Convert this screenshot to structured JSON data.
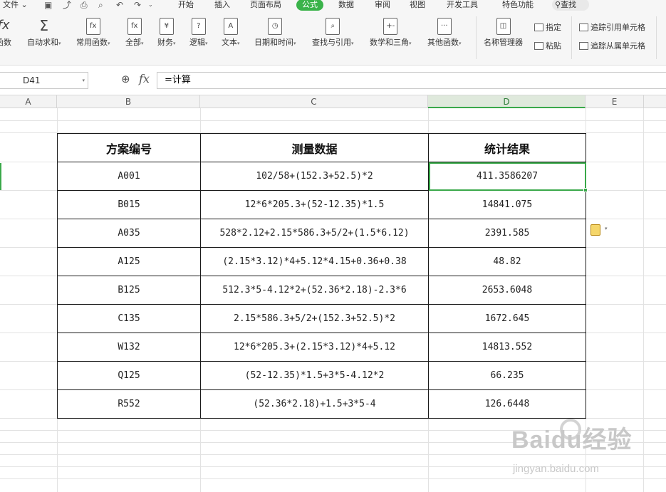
{
  "menubar": {
    "file": "文件",
    "tabs": [
      "开始",
      "插入",
      "页面布局",
      "公式",
      "数据",
      "审阅",
      "视图",
      "开发工具",
      "特色功能"
    ],
    "active_tab": "公式",
    "search": "查找"
  },
  "ribbon": {
    "buttons": [
      {
        "label": "函数",
        "icon": "fx"
      },
      {
        "label": "自动求和",
        "icon": "Σ"
      },
      {
        "label": "常用函数",
        "icon": "fx"
      },
      {
        "label": "全部",
        "icon": "fx"
      },
      {
        "label": "财务",
        "icon": "¥"
      },
      {
        "label": "逻辑",
        "icon": "?"
      },
      {
        "label": "文本",
        "icon": "A"
      },
      {
        "label": "日期和时间",
        "icon": "◷"
      },
      {
        "label": "查找与引用",
        "icon": "⌕"
      },
      {
        "label": "数学和三角",
        "icon": "+-"
      },
      {
        "label": "其他函数",
        "icon": "···"
      },
      {
        "label": "名称管理器",
        "icon": "◫"
      }
    ],
    "small": {
      "specify": "指定",
      "paste": "粘贴",
      "trace_precedents": "追踪引用单元格",
      "trace_dependents": "追踪从属单元格"
    }
  },
  "formula_bar": {
    "cell_ref": "D41",
    "formula": "=计算"
  },
  "columns": [
    "A",
    "B",
    "C",
    "D",
    "E"
  ],
  "selected_column": "D",
  "table": {
    "headers": [
      "方案编号",
      "测量数据",
      "统计结果"
    ],
    "rows": [
      [
        "A001",
        "102/58+(152.3+52.5)*2",
        "411.3586207"
      ],
      [
        "B015",
        "12*6*205.3+(52-12.35)*1.5",
        "14841.075"
      ],
      [
        "A035",
        "528*2.12+2.15*586.3+5/2+(1.5*6.12)",
        "2391.585"
      ],
      [
        "A125",
        "(2.15*3.12)*4+5.12*4.15+0.36+0.38",
        "48.82"
      ],
      [
        "B125",
        "512.3*5-4.12*2+(52.36*2.18)-2.3*6",
        "2653.6048"
      ],
      [
        "C135",
        "2.15*586.3+5/2+(152.3+52.5)*2",
        "1672.645"
      ],
      [
        "W132",
        "12*6*205.3+(2.15*3.12)*4+5.12",
        "14813.552"
      ],
      [
        "Q125",
        "(52-12.35)*1.5+3*5-4.12*2",
        "66.235"
      ],
      [
        "R552",
        "(52.36*2.18)+1.5+3*5-4",
        "126.6448"
      ]
    ]
  },
  "watermark": {
    "brand": "Baidu经验",
    "url": "jingyan.baidu.com"
  },
  "colors": {
    "accent_green": "#3aa84a",
    "active_tab_bg": "#3ab34a"
  }
}
